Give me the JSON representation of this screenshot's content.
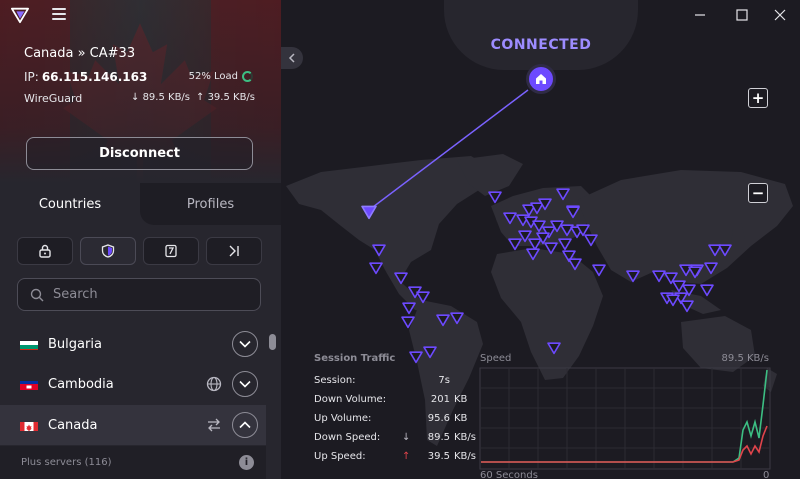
{
  "app": {
    "window_controls": [
      "minimize-icon",
      "maximize-icon",
      "close-icon"
    ]
  },
  "connection": {
    "server": "Canada » CA#33",
    "ip_label": "IP:",
    "ip": "66.115.146.163",
    "load": "52% Load",
    "load_fraction": 0.52,
    "protocol": "WireGuard",
    "down_speed": "89.5 KB/s",
    "up_speed": "39.5 KB/s",
    "disconnect_label": "Disconnect",
    "status": "CONNECTED"
  },
  "tabs": [
    {
      "label": "Countries",
      "active": true
    },
    {
      "label": "Profiles",
      "active": false
    }
  ],
  "filters": [
    "lock-icon",
    "shield-icon",
    "p2p-icon",
    "tor-icon"
  ],
  "search": {
    "placeholder": "Search",
    "value": ""
  },
  "countries": [
    {
      "name": "Bulgaria",
      "flag": "bg",
      "expanded": false,
      "features": []
    },
    {
      "name": "Cambodia",
      "flag": "kh",
      "expanded": false,
      "features": [
        "globe-icon"
      ]
    },
    {
      "name": "Canada",
      "flag": "ca",
      "expanded": true,
      "features": [
        "p2p-arrows-icon"
      ]
    }
  ],
  "subheader": {
    "label": "Plus servers (116)"
  },
  "session": {
    "title": "Session Traffic",
    "rows": [
      {
        "label": "Session:",
        "value": "7s",
        "unit": "",
        "arrow": ""
      },
      {
        "label": "Down Volume:",
        "value": "201",
        "unit": "KB",
        "arrow": ""
      },
      {
        "label": "Up Volume:",
        "value": "95.6",
        "unit": "KB",
        "arrow": ""
      },
      {
        "label": "Down Speed:",
        "value": "89.5",
        "unit": "KB/s",
        "arrow": "↓"
      },
      {
        "label": "Up Speed:",
        "value": "39.5",
        "unit": "KB/s",
        "arrow": "↑"
      }
    ]
  },
  "speed_graph": {
    "title": "Speed",
    "max_label": "89.5  KB/s",
    "x_left": "60 Seconds",
    "x_right": "0",
    "colors": {
      "down": "#3cbf83",
      "up": "#e0444b"
    }
  },
  "colors": {
    "accent": "#6d4aff",
    "connected": "#9d8cff",
    "map_land": "#2f2e36",
    "server_pin": "#6d4aff"
  }
}
